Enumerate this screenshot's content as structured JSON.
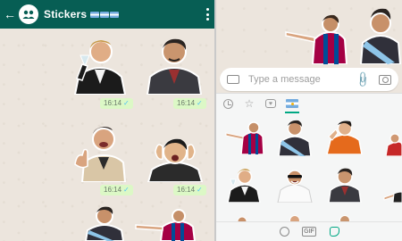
{
  "chat": {
    "title": "Stickers",
    "flags_count": 3,
    "messages": [
      {
        "sticker": "man-raising-glass",
        "time": "16:14"
      },
      {
        "sticker": "man-in-suit-sad",
        "time": "16:14"
      },
      {
        "sticker": "man-thumbs-up",
        "time": "16:14"
      },
      {
        "sticker": "man-surprised",
        "time": "16:14"
      },
      {
        "sticker": "man-with-sash",
        "time": ""
      },
      {
        "sticker": "footballer-pointing",
        "time": ""
      }
    ]
  },
  "composer": {
    "placeholder": "Type a message"
  },
  "sticker_panel": {
    "tabs": [
      "recent-icon",
      "star-icon",
      "heart-pack-icon",
      "argentina-pack-icon"
    ],
    "active_tab": 3,
    "bottom_buttons": [
      "emoji-icon",
      "gif-icon",
      "sticker-icon"
    ],
    "active_bottom": 2
  },
  "colors": {
    "header": "#075e54",
    "bubble": "#dcf8c6",
    "accent": "#00a884",
    "wallpaper": "#ece5dd",
    "tick": "#4fc3f7"
  }
}
